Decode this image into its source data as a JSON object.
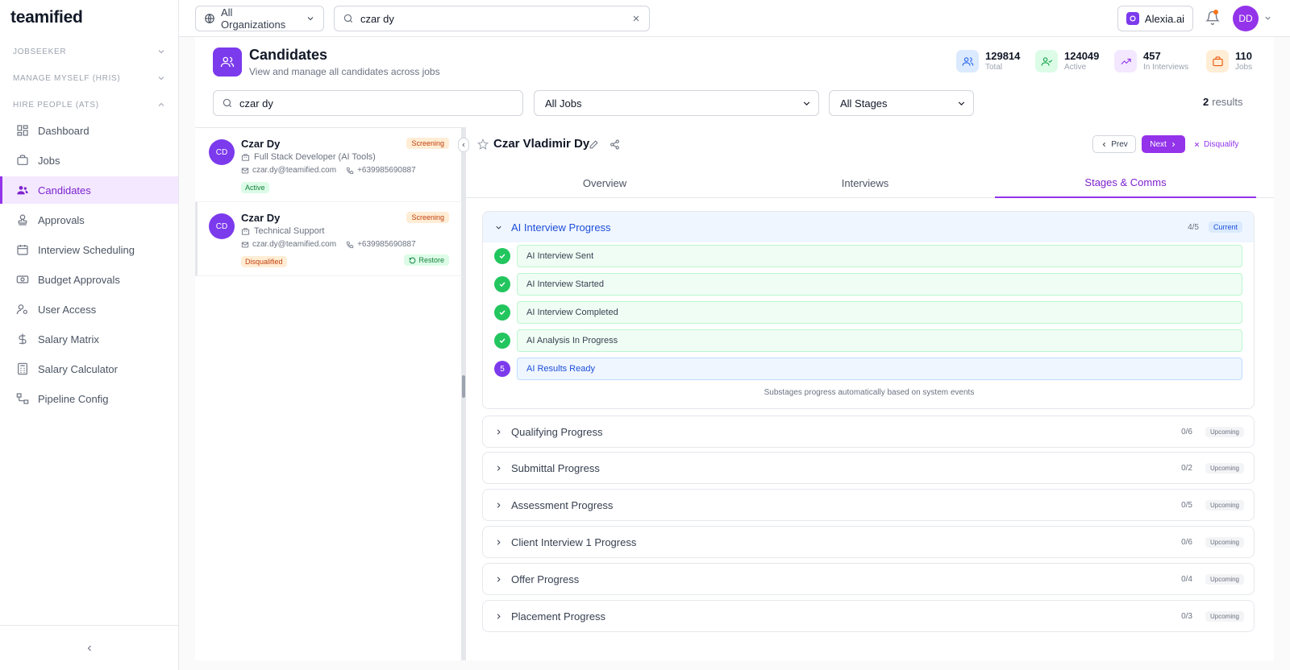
{
  "app": {
    "logo": "teamified"
  },
  "sidebar": {
    "sections": [
      {
        "label": "JOBSEEKER"
      },
      {
        "label": "MANAGE MYSELF (HRIS)"
      },
      {
        "label": "HIRE PEOPLE (ATS)"
      }
    ],
    "items": [
      {
        "label": "Dashboard",
        "icon": "dashboard-icon"
      },
      {
        "label": "Jobs",
        "icon": "briefcase-icon"
      },
      {
        "label": "Candidates",
        "icon": "users-icon",
        "active": true
      },
      {
        "label": "Approvals",
        "icon": "stamp-icon"
      },
      {
        "label": "Interview Scheduling",
        "icon": "calendar-icon"
      },
      {
        "label": "Budget Approvals",
        "icon": "money-icon"
      },
      {
        "label": "User Access",
        "icon": "user-gear-icon"
      },
      {
        "label": "Salary Matrix",
        "icon": "dollar-icon"
      },
      {
        "label": "Salary Calculator",
        "icon": "calculator-icon"
      },
      {
        "label": "Pipeline Config",
        "icon": "workflow-icon"
      }
    ]
  },
  "topbar": {
    "org_select": "All Organizations",
    "search_value": "czar dy",
    "alexia_label": "Alexia.ai",
    "avatar_initials": "DD"
  },
  "page": {
    "title": "Candidates",
    "subtitle": "View and manage all candidates across jobs"
  },
  "stats": [
    {
      "value": "129814",
      "label": "Total",
      "color": "#dbeafe",
      "icon_color": "#2563eb"
    },
    {
      "value": "124049",
      "label": "Active",
      "color": "#dcfce7",
      "icon_color": "#16a34a"
    },
    {
      "value": "457",
      "label": "In Interviews",
      "color": "#f3e8ff",
      "icon_color": "#9333ea"
    },
    {
      "value": "110",
      "label": "Jobs",
      "color": "#ffedd5",
      "icon_color": "#ea580c"
    }
  ],
  "filters": {
    "search_value": "czar dy",
    "jobs": "All Jobs",
    "stages": "All Stages",
    "results_count": "2",
    "results_label": "results"
  },
  "candidates": [
    {
      "initials": "CD",
      "name": "Czar Dy",
      "role": "Full Stack Developer (AI Tools)",
      "email": "czar.dy@teamified.com",
      "phone": "+639985690887",
      "stage_badge": "Screening",
      "status": "Active"
    },
    {
      "initials": "CD",
      "name": "Czar Dy",
      "role": "Technical Support",
      "email": "czar.dy@teamified.com",
      "phone": "+639985690887",
      "stage_badge": "Screening",
      "status": "Disqualified",
      "restore_label": "Restore"
    }
  ],
  "detail": {
    "name": "Czar Vladimir Dy",
    "prev_label": "Prev",
    "next_label": "Next",
    "disqualify_label": "Disqualify",
    "tabs": [
      {
        "label": "Overview"
      },
      {
        "label": "Interviews"
      },
      {
        "label": "Stages & Comms",
        "active": true
      }
    ],
    "current_stage": {
      "title": "AI Interview Progress",
      "count": "4/5",
      "badge": "Current",
      "substages": [
        {
          "label": "AI Interview Sent",
          "done": true
        },
        {
          "label": "AI Interview Started",
          "done": true
        },
        {
          "label": "AI Interview Completed",
          "done": true
        },
        {
          "label": "AI Analysis In Progress",
          "done": true
        },
        {
          "label": "AI Results Ready",
          "done": false,
          "number": "5"
        }
      ],
      "note": "Substages progress automatically based on system events"
    },
    "stages": [
      {
        "title": "Qualifying Progress",
        "count": "0/6",
        "badge": "Upcoming"
      },
      {
        "title": "Submittal Progress",
        "count": "0/2",
        "badge": "Upcoming"
      },
      {
        "title": "Assessment Progress",
        "count": "0/5",
        "badge": "Upcoming"
      },
      {
        "title": "Client Interview 1 Progress",
        "count": "0/6",
        "badge": "Upcoming"
      },
      {
        "title": "Offer Progress",
        "count": "0/4",
        "badge": "Upcoming"
      },
      {
        "title": "Placement Progress",
        "count": "0/3",
        "badge": "Upcoming"
      }
    ]
  }
}
